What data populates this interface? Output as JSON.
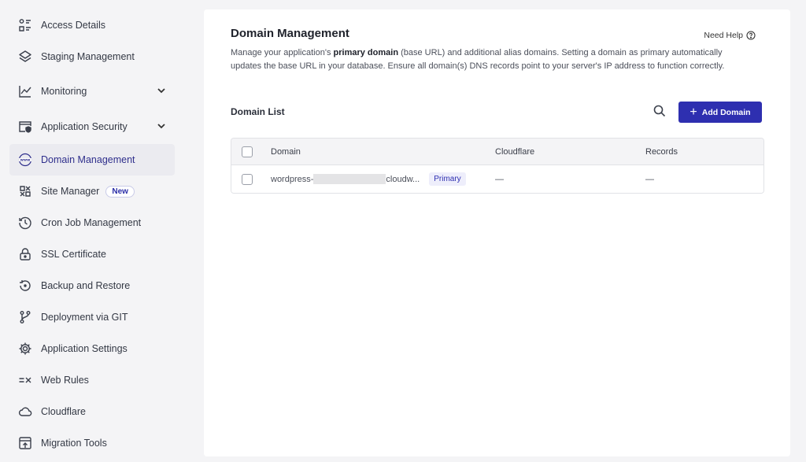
{
  "sidebar": {
    "items": [
      {
        "label": "Access Details",
        "icon": "access-details-icon"
      },
      {
        "label": "Staging Management",
        "icon": "layers-icon"
      },
      {
        "label": "Monitoring",
        "icon": "line-chart-icon",
        "expandable": true
      },
      {
        "label": "Application Security",
        "icon": "shield-window-icon",
        "expandable": true
      },
      {
        "label": "Domain Management",
        "icon": "www-globe-icon",
        "active": true
      },
      {
        "label": "Site Manager",
        "icon": "site-manager-icon",
        "badge": "New"
      },
      {
        "label": "Cron Job Management",
        "icon": "clock-history-icon"
      },
      {
        "label": "SSL Certificate",
        "icon": "lock-icon"
      },
      {
        "label": "Backup and Restore",
        "icon": "backup-restore-icon"
      },
      {
        "label": "Deployment via GIT",
        "icon": "git-branch-icon"
      },
      {
        "label": "Application Settings",
        "icon": "gear-icon"
      },
      {
        "label": "Web Rules",
        "icon": "web-rules-icon"
      },
      {
        "label": "Cloudflare",
        "icon": "cloud-icon"
      },
      {
        "label": "Migration Tools",
        "icon": "migration-icon"
      }
    ]
  },
  "main": {
    "title": "Domain Management",
    "need_help": "Need Help",
    "description_pre": "Manage your application's ",
    "description_bold": "primary domain",
    "description_post": " (base URL) and additional alias domains. Setting a domain as primary automatically updates the base URL in your database. Ensure all domain(s) DNS records point to your server's IP address to function correctly.",
    "list_title": "Domain List",
    "add_button": "Add Domain"
  },
  "table": {
    "columns": [
      "Domain",
      "Cloudflare",
      "Records"
    ],
    "rows": [
      {
        "domain_prefix": "wordpress-",
        "domain_suffix": "cloudw...",
        "badge": "Primary",
        "cloudflare": "—",
        "records": "—"
      }
    ]
  },
  "colors": {
    "accent": "#2e2fb0",
    "active_bg": "#ebebf0",
    "page_bg": "#f4f4f6"
  }
}
